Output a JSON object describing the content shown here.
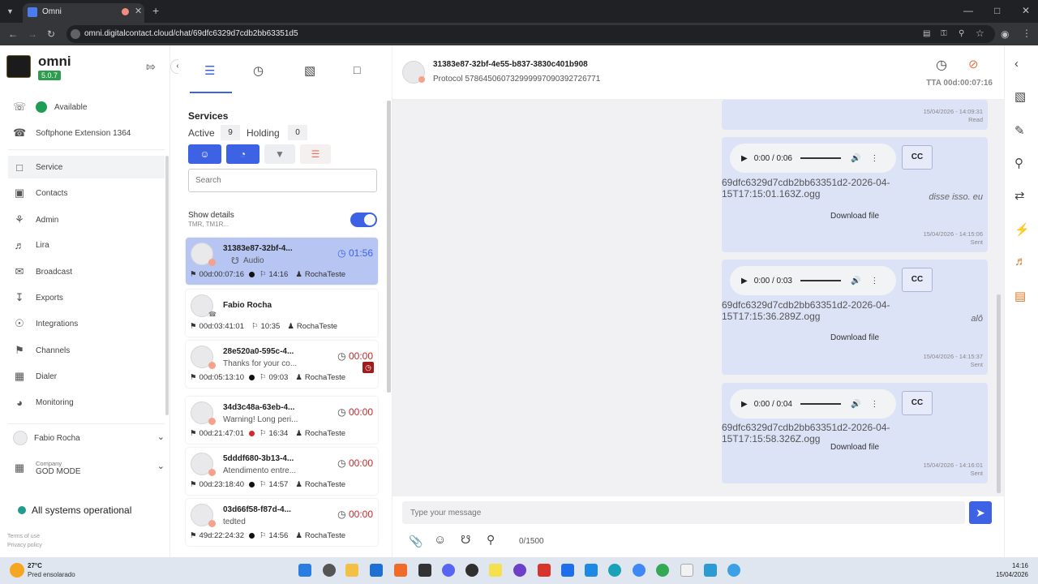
{
  "browser": {
    "tab_title": "Omni",
    "url": "omni.digitalcontact.cloud/chat/69dfc6329d7cdb2bb63351d5"
  },
  "app": {
    "name": "omni",
    "version": "5.0.7",
    "accent_color": "#3d63e4"
  },
  "leftnav": {
    "status_label": "Available",
    "softphone_label": "Softphone Extension 1364",
    "items": [
      {
        "label": "Service",
        "icon": "chat-icon"
      },
      {
        "label": "Contacts",
        "icon": "contacts-icon"
      },
      {
        "label": "Admin",
        "icon": "admin-icon"
      },
      {
        "label": "Lira",
        "icon": "lira-icon"
      },
      {
        "label": "Broadcast",
        "icon": "broadcast-icon"
      },
      {
        "label": "Exports",
        "icon": "download-icon"
      },
      {
        "label": "Integrations",
        "icon": "integrations-icon"
      },
      {
        "label": "Channels",
        "icon": "megaphone-icon"
      },
      {
        "label": "Dialer",
        "icon": "dialer-icon"
      },
      {
        "label": "Monitoring",
        "icon": "monitoring-icon"
      }
    ],
    "user_name": "Fabio Rocha",
    "company_label": "Company",
    "company_value": "GOD MODE",
    "system_status": "All systems operational",
    "terms": "Terms of use",
    "privacy": "Privacy policy"
  },
  "services": {
    "heading": "Services",
    "active_label": "Active",
    "active_count": "9",
    "holding_label": "Holding",
    "holding_count": "0",
    "search_placeholder": "Search",
    "show_details_label": "Show details",
    "show_details_sub": "TMR, TM1R...",
    "cards": [
      {
        "title": "31383e87-32bf-4...",
        "sub": "Audio",
        "timer": "01:56",
        "duration": "00d:00:07:16",
        "time": "14:16",
        "agent": "RochaTeste",
        "dot": "#111111"
      },
      {
        "title": "Fabio Rocha",
        "sub": "",
        "timer": "",
        "duration": "00d:03:41:01",
        "time": "10:35",
        "agent": "RochaTeste",
        "dot": ""
      },
      {
        "title": "28e520a0-595c-4...",
        "sub": "Thanks for your co...",
        "timer": "00:00",
        "duration": "00d:05:13:10",
        "time": "09:03",
        "agent": "RochaTeste",
        "dot": "#111111"
      },
      {
        "title": "34d3c48a-63eb-4...",
        "sub": "Warning! Long peri...",
        "timer": "00:00",
        "duration": "00d:21:47:01",
        "time": "16:34",
        "agent": "RochaTeste",
        "dot": "#d62828"
      },
      {
        "title": "5dddf680-3b13-4...",
        "sub": "Atendimento entre...",
        "timer": "00:00",
        "duration": "00d:23:18:40",
        "time": "14:57",
        "agent": "RochaTeste",
        "dot": "#111111"
      },
      {
        "title": "03d66f58-f87d-4...",
        "sub": "tedted",
        "timer": "00:00",
        "duration": "49d:22:24:32",
        "time": "14:56",
        "agent": "RochaTeste",
        "dot": "#111111"
      }
    ]
  },
  "chat": {
    "contact_id": "31383e87-32bf-4e55-b837-3830c401b908",
    "protocol": "Protocol 578645060732999997090392726771",
    "tta": "TTA 00d:00:07:16",
    "top_stamp_date": "15/04/2026 - 14:09:31",
    "top_stamp_status": "Read",
    "messages": [
      {
        "audio_time": "0:00 / 0:06",
        "cc": "CC",
        "filename": "69dfc6329d7cdb2bb63351d2-2026-04-15T17:15:01.163Z.ogg",
        "caption": "disse isso. eu",
        "download": "Download file",
        "date": "15/04/2026 - 14:15:06",
        "status": "Sent"
      },
      {
        "audio_time": "0:00 / 0:03",
        "cc": "CC",
        "filename": "69dfc6329d7cdb2bb63351d2-2026-04-15T17:15:36.289Z.ogg",
        "caption": "alô",
        "download": "Download file",
        "date": "15/04/2026 - 14:15:37",
        "status": "Sent"
      },
      {
        "audio_time": "0:00 / 0:04",
        "cc": "CC",
        "filename": "69dfc6329d7cdb2bb63351d2-2026-04-15T17:15:58.326Z.ogg",
        "caption": "",
        "download": "Download file",
        "date": "15/04/2026 - 14:16:01",
        "status": "Sent"
      }
    ],
    "composer_placeholder": "Type your message",
    "char_count": "0/1500"
  },
  "taskbar": {
    "weather_temp": "27°C",
    "weather_desc": "Pred ensolarado",
    "clock_time": "14:16",
    "clock_date": "15/04/2026"
  }
}
